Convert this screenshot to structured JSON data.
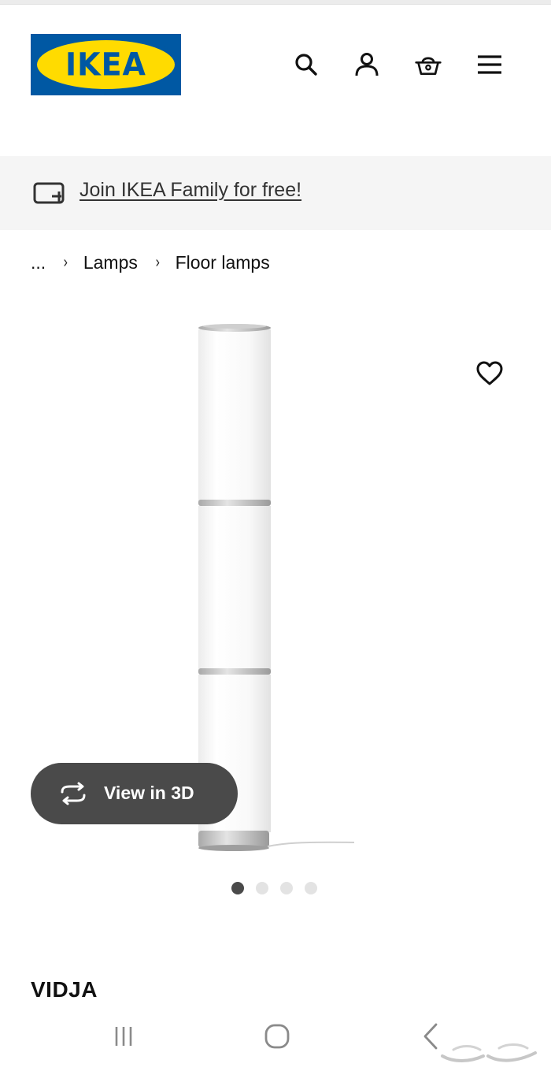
{
  "brand": {
    "logo_text": "IKEA",
    "registered_mark": "®",
    "colors": {
      "blue": "#0058a3",
      "yellow": "#ffdb00"
    }
  },
  "header": {
    "icons": [
      "search-icon",
      "user-icon",
      "basket-icon",
      "menu-icon"
    ]
  },
  "family_banner": {
    "icon": "member-card-icon",
    "link_text": "Join IKEA Family for free!"
  },
  "breadcrumb": {
    "ellipsis": "...",
    "separator": "›",
    "items": [
      "Lamps",
      "Floor lamps"
    ]
  },
  "product": {
    "name": "VIDJA",
    "favourite_icon": "heart-outline-icon",
    "view_3d_label": "View in 3D",
    "view_3d_icon": "rotate-arrows-icon",
    "gallery": {
      "image_count": 4,
      "active_index": 0
    }
  },
  "system_nav": {
    "icons": [
      "recent-apps-icon",
      "home-icon",
      "back-icon"
    ]
  }
}
